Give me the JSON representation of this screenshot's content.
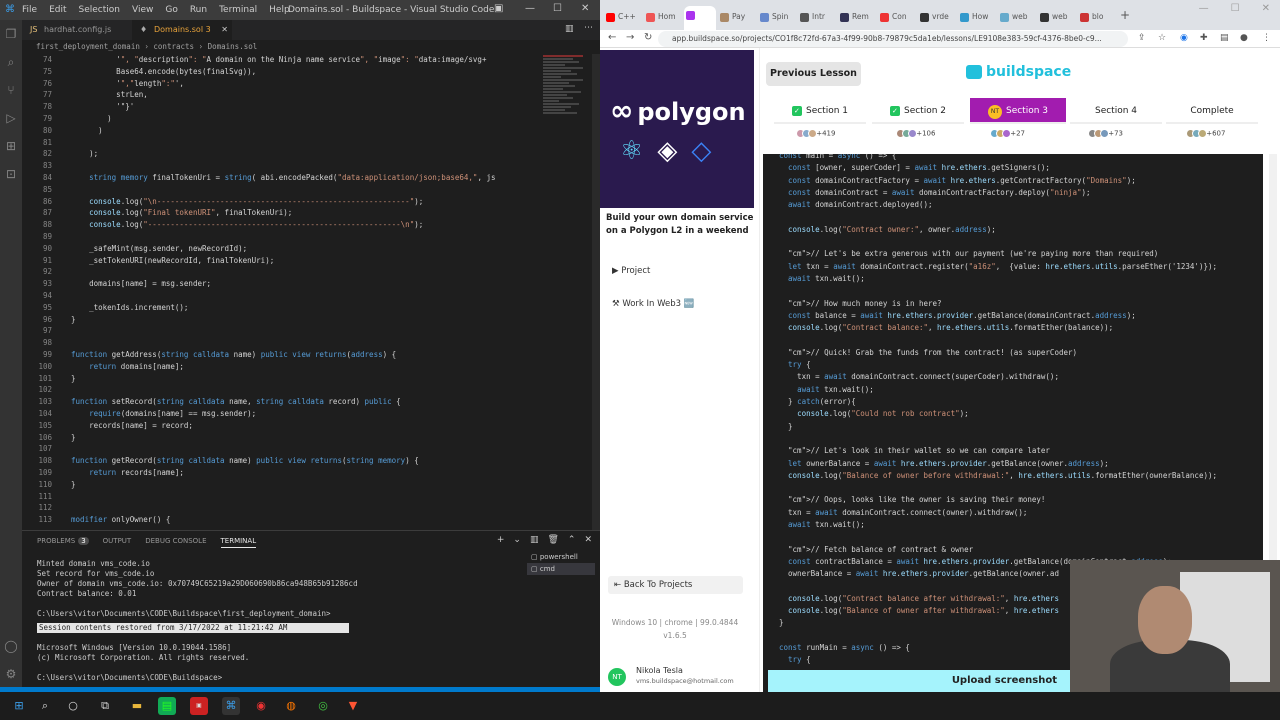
{
  "vscode": {
    "menu": [
      "File",
      "Edit",
      "Selection",
      "View",
      "Go",
      "Run",
      "Terminal",
      "Help"
    ],
    "window_title": "Domains.sol - Buildspace - Visual Studio Code",
    "tabs": [
      {
        "label": "hardhat.config.js"
      },
      {
        "label": "Domains.sol 3"
      }
    ],
    "breadcrumb": "first_deployment_domain › contracts › Domains.sol",
    "code_lines": [
      {
        "n": "74",
        "t": "            '\", \"description\": \"A domain on the Ninja name service\", \"image\": \"data:image/svg+"
      },
      {
        "n": "75",
        "t": "            Base64.encode(bytes(finalSvg)),"
      },
      {
        "n": "76",
        "t": "            '\",\"length\":\"',"
      },
      {
        "n": "77",
        "t": "            strLen,"
      },
      {
        "n": "78",
        "t": "            '\"}'"
      },
      {
        "n": "79",
        "t": "          )"
      },
      {
        "n": "80",
        "t": "        )"
      },
      {
        "n": "81",
        "t": ""
      },
      {
        "n": "82",
        "t": "      );"
      },
      {
        "n": "83",
        "t": ""
      },
      {
        "n": "84",
        "t": "      string memory finalTokenUri = string( abi.encodePacked(\"data:application/json;base64,\", js"
      },
      {
        "n": "85",
        "t": ""
      },
      {
        "n": "86",
        "t": "      console.log(\"\\n--------------------------------------------------------\");"
      },
      {
        "n": "87",
        "t": "      console.log(\"Final tokenURI\", finalTokenUri);"
      },
      {
        "n": "88",
        "t": "      console.log(\"--------------------------------------------------------\\n\");"
      },
      {
        "n": "89",
        "t": ""
      },
      {
        "n": "90",
        "t": "      _safeMint(msg.sender, newRecordId);"
      },
      {
        "n": "91",
        "t": "      _setTokenURI(newRecordId, finalTokenUri);"
      },
      {
        "n": "92",
        "t": ""
      },
      {
        "n": "93",
        "t": "      domains[name] = msg.sender;"
      },
      {
        "n": "94",
        "t": ""
      },
      {
        "n": "95",
        "t": "      _tokenIds.increment();"
      },
      {
        "n": "96",
        "t": "  }"
      },
      {
        "n": "97",
        "t": ""
      },
      {
        "n": "98",
        "t": ""
      },
      {
        "n": "99",
        "t": "  function getAddress(string calldata name) public view returns(address) {"
      },
      {
        "n": "100",
        "t": "      return domains[name];"
      },
      {
        "n": "101",
        "t": "  }"
      },
      {
        "n": "102",
        "t": ""
      },
      {
        "n": "103",
        "t": "  function setRecord(string calldata name, string calldata record) public {"
      },
      {
        "n": "104",
        "t": "      require(domains[name] == msg.sender);"
      },
      {
        "n": "105",
        "t": "      records[name] = record;"
      },
      {
        "n": "106",
        "t": "  }"
      },
      {
        "n": "107",
        "t": ""
      },
      {
        "n": "108",
        "t": "  function getRecord(string calldata name) public view returns(string memory) {"
      },
      {
        "n": "109",
        "t": "      return records[name];"
      },
      {
        "n": "110",
        "t": "  }"
      },
      {
        "n": "111",
        "t": ""
      },
      {
        "n": "112",
        "t": ""
      },
      {
        "n": "113",
        "t": "  modifier onlyOwner() {"
      }
    ],
    "panel_tabs": [
      "PROBLEMS",
      "OUTPUT",
      "DEBUG CONSOLE",
      "TERMINAL"
    ],
    "problems_count": "3",
    "terminal_lines": [
      "Minted domain vms_code.io",
      "Set record for vms_code.io",
      "Owner of domain vms_code.io: 0x70749C65219a29D060690b86ca948B65b91286cd",
      "Contract balance: 0.01",
      "",
      "C:\\Users\\vitor\\Documents\\CODE\\Buildspace\\first_deployment_domain>",
      "",
      "Microsoft Windows [Version 10.0.19044.1586]",
      "(c) Microsoft Corporation. All rights reserved.",
      "",
      "C:\\Users\\vitor\\Documents\\CODE\\Buildspace>"
    ],
    "session_restored": "Session contents restored from 3/17/2022 at 11:21:42 AM",
    "terminal_list": [
      "powershell",
      "cmd"
    ]
  },
  "browser": {
    "tabs": [
      "C++",
      "Hom",
      "",
      "Pay",
      "Spin",
      "Intr",
      "Rem",
      "Con",
      "vrde",
      "How",
      "web",
      "web",
      "blo"
    ],
    "url": "app.buildspace.so/projects/CO1f8c72fd-67a3-4f99-90b8-79879c5da1eb/lessons/LE9108e383-59cf-4376-8be0-c9...",
    "polygon_word": "polygon",
    "project_desc": "Build your own domain service on a Polygon L2 in a weekend",
    "side_links": [
      "Project",
      "Work In Web3 🆕"
    ],
    "back_label": "Back To Projects",
    "sysinfo": [
      "Windows 10 | chrome | 99.0.4844",
      "v1.6.5"
    ],
    "user_name": "Nikola Tesla",
    "user_email": "vms.buildspace@hotmail.com",
    "user_initials": "NT",
    "prev_lesson": "Previous Lesson",
    "brand": "buildspace",
    "sections": [
      {
        "label": "Section 1",
        "count": "+419"
      },
      {
        "label": "Section 2",
        "count": "+106"
      },
      {
        "label": "Section 3",
        "count": "+27"
      },
      {
        "label": "Section 4",
        "count": "+73"
      },
      {
        "label": "Complete",
        "count": "+607"
      }
    ],
    "code_lines": [
      "const main = async () => {",
      "  const [owner, superCoder] = await hre.ethers.getSigners();",
      "  const domainContractFactory = await hre.ethers.getContractFactory(\"Domains\");",
      "  const domainContract = await domainContractFactory.deploy(\"ninja\");",
      "  await domainContract.deployed();",
      "",
      "  console.log(\"Contract owner:\", owner.address);",
      "",
      "  // Let's be extra generous with our payment (we're paying more than required)",
      "  let txn = await domainContract.register(\"a16z\",  {value: hre.ethers.utils.parseEther('1234')});",
      "  await txn.wait();",
      "",
      "  // How much money is in here?",
      "  const balance = await hre.ethers.provider.getBalance(domainContract.address);",
      "  console.log(\"Contract balance:\", hre.ethers.utils.formatEther(balance));",
      "",
      "  // Quick! Grab the funds from the contract! (as superCoder)",
      "  try {",
      "    txn = await domainContract.connect(superCoder).withdraw();",
      "    await txn.wait();",
      "  } catch(error){",
      "    console.log(\"Could not rob contract\");",
      "  }",
      "",
      "  // Let's look in their wallet so we can compare later",
      "  let ownerBalance = await hre.ethers.provider.getBalance(owner.address);",
      "  console.log(\"Balance of owner before withdrawal:\", hre.ethers.utils.formatEther(ownerBalance));",
      "",
      "  // Oops, looks like the owner is saving their money!",
      "  txn = await domainContract.connect(owner).withdraw();",
      "  await txn.wait();",
      "",
      "  // Fetch balance of contract & owner",
      "  const contractBalance = await hre.ethers.provider.getBalance(domainContract.address);",
      "  ownerBalance = await hre.ethers.provider.getBalance(owner.ad",
      "",
      "  console.log(\"Contract balance after withdrawal:\", hre.ethers",
      "  console.log(\"Balance of owner after withdrawal:\", hre.ethers",
      "}",
      "",
      "const runMain = async () => {",
      "  try {"
    ],
    "upload_label": "Upload screenshot"
  }
}
